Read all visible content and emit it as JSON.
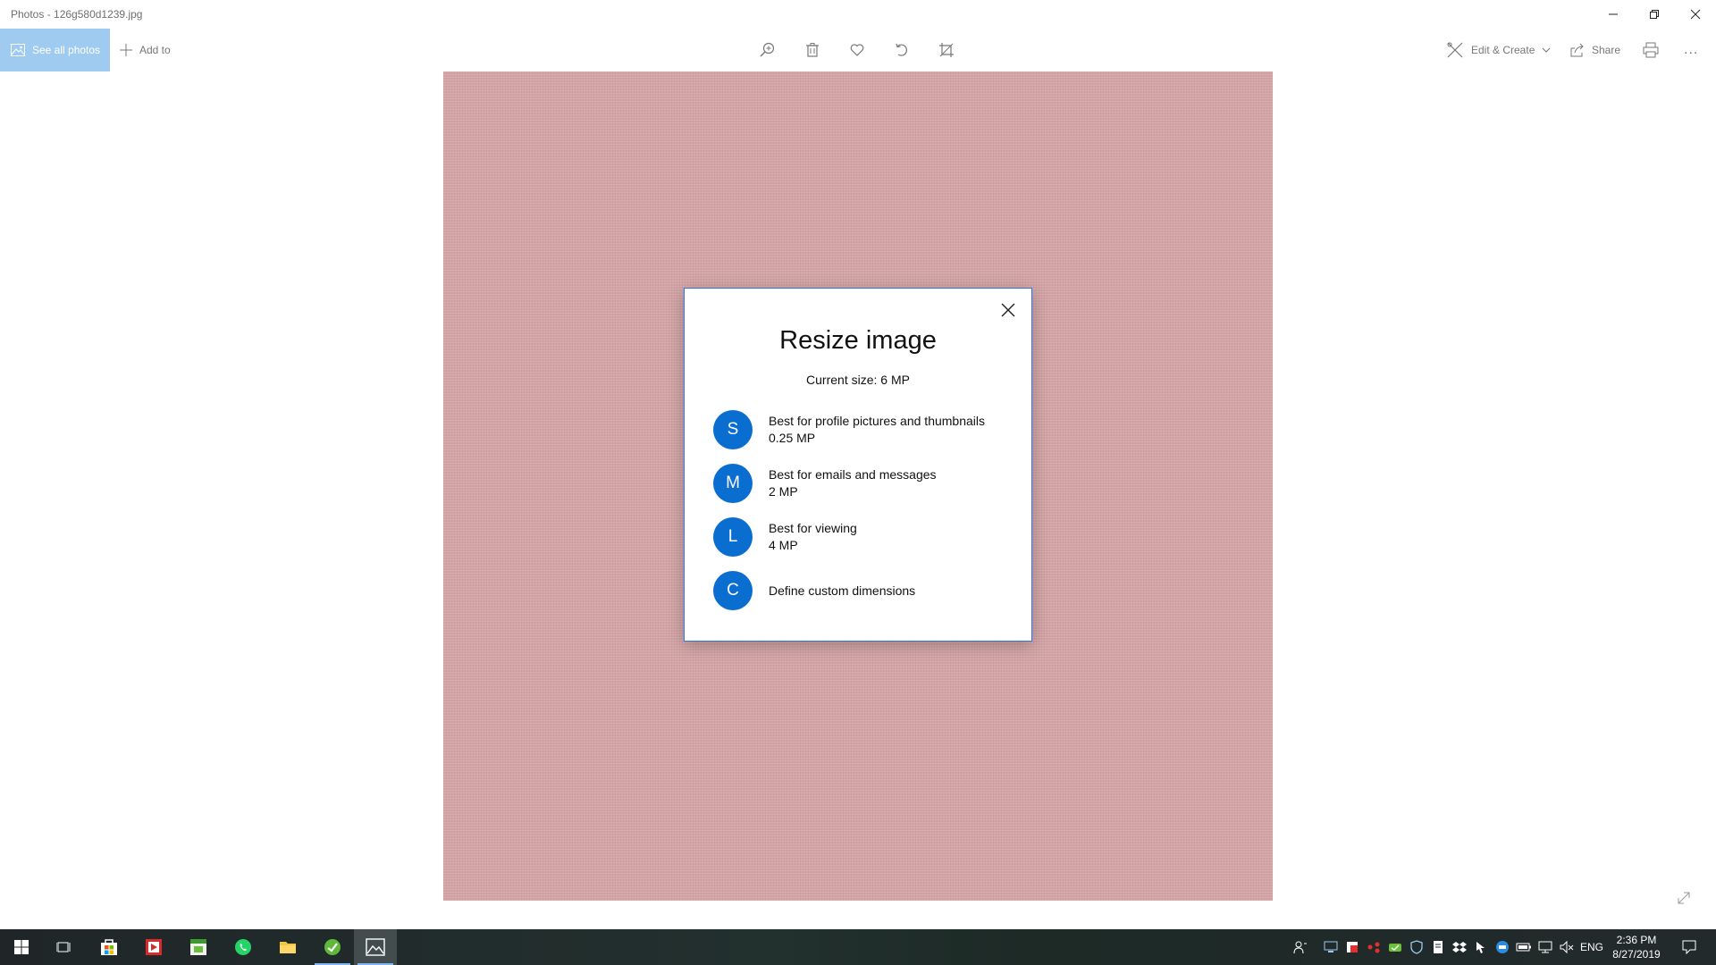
{
  "window": {
    "title": "Photos - 126g580d1239.jpg",
    "controls": [
      "minimize",
      "restore",
      "close"
    ]
  },
  "toolbar": {
    "see_all_label": "See all photos",
    "add_to_label": "Add to",
    "center_tools": [
      "zoom-icon",
      "delete-icon",
      "favorite-icon",
      "rotate-icon",
      "crop-icon"
    ],
    "edit_create_label": "Edit & Create",
    "share_label": "Share",
    "print_icon": "print-icon",
    "more_label": "..."
  },
  "dialog": {
    "title": "Resize image",
    "current_size": "Current size: 6 MP",
    "options": [
      {
        "letter": "S",
        "line1": "Best for profile pictures and thumbnails",
        "line2": "0.25 MP"
      },
      {
        "letter": "M",
        "line1": "Best for emails and messages",
        "line2": "2 MP"
      },
      {
        "letter": "L",
        "line1": "Best for viewing",
        "line2": "4 MP"
      },
      {
        "letter": "C",
        "line1": "Define custom dimensions",
        "line2": ""
      }
    ]
  },
  "colors": {
    "accent": "#0a6ed1",
    "see_all_bg": "#9fcbf0",
    "photo_bg": "#d3a4a6",
    "dialog_border": "#2d7ad6",
    "taskbar": "#202628"
  },
  "taskbar": {
    "apps": [
      "start-icon",
      "task-view-icon",
      "store-icon",
      "red-app-icon",
      "green-app-icon",
      "whatsapp-icon",
      "file-explorer-icon",
      "greenshot-icon",
      "photos-icon"
    ],
    "language": "ENG",
    "time": "2:36 PM",
    "date": "8/27/2019"
  }
}
